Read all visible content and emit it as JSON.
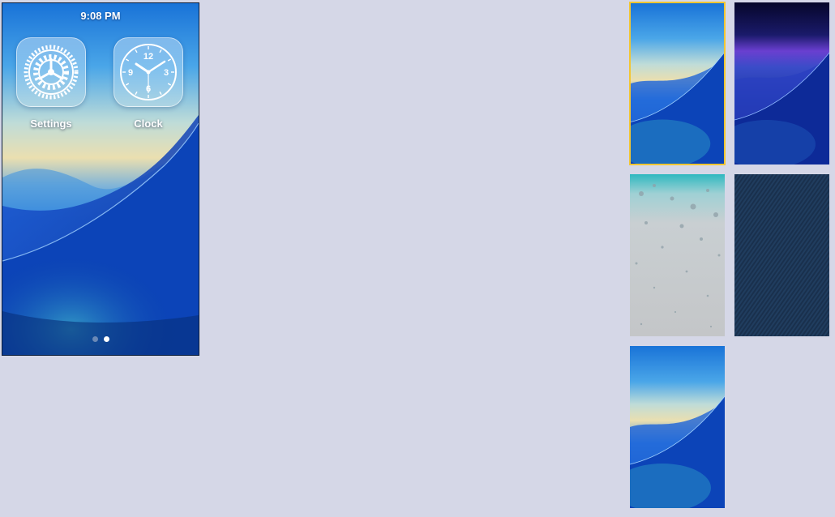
{
  "status_bar": {
    "time": "9:08 PM"
  },
  "home_screen": {
    "apps": [
      {
        "label": "Settings",
        "icon": "settings-gear-icon"
      },
      {
        "label": "Clock",
        "icon": "clock-icon",
        "numbers": [
          "12",
          "3",
          "6",
          "9"
        ]
      }
    ],
    "page_count": 2,
    "current_page": 2
  },
  "wallpapers": [
    {
      "name": "blue-wave",
      "selected": true
    },
    {
      "name": "purple-wave",
      "selected": false
    },
    {
      "name": "water-drops",
      "selected": false
    },
    {
      "name": "denim",
      "selected": false
    },
    {
      "name": "blue-wave-alt",
      "selected": false
    }
  ],
  "colors": {
    "background": "#d5d7e7",
    "selection": "#f3c632",
    "wallpaper_sky_top": "#1e74d8",
    "wallpaper_sand": "#eadfb0",
    "wallpaper_deep": "#0a3aa6"
  }
}
